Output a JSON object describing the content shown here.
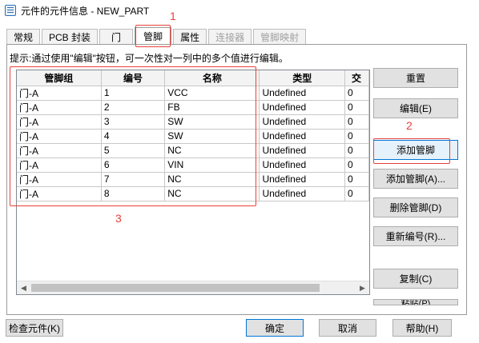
{
  "window": {
    "title": "元件的元件信息 - NEW_PART"
  },
  "tabs": [
    {
      "label": "常规"
    },
    {
      "label": "PCB 封装"
    },
    {
      "label": "门"
    },
    {
      "label": "管脚"
    },
    {
      "label": "属性"
    },
    {
      "label": "连接器"
    },
    {
      "label": "管脚映射"
    }
  ],
  "hint": "提示:通过使用\"编辑\"按钮，可一次性对一列中的多个值进行编辑。",
  "table": {
    "columns": [
      "管脚组",
      "编号",
      "名称",
      "类型",
      "交"
    ],
    "rows": [
      [
        "门-A",
        "1",
        "VCC",
        "Undefined",
        "0"
      ],
      [
        "门-A",
        "2",
        "FB",
        "Undefined",
        "0"
      ],
      [
        "门-A",
        "3",
        "SW",
        "Undefined",
        "0"
      ],
      [
        "门-A",
        "4",
        "SW",
        "Undefined",
        "0"
      ],
      [
        "门-A",
        "5",
        "NC",
        "Undefined",
        "0"
      ],
      [
        "门-A",
        "6",
        "VIN",
        "Undefined",
        "0"
      ],
      [
        "门-A",
        "7",
        "NC",
        "Undefined",
        "0"
      ],
      [
        "门-A",
        "8",
        "NC",
        "Undefined",
        "0"
      ]
    ]
  },
  "side_buttons": {
    "reset": "重置",
    "edit": "编辑(E)",
    "add_pin": "添加管脚",
    "add_pins": "添加管脚(A)...",
    "delete_pin": "删除管脚(D)",
    "renumber": "重新编号(R)...",
    "copy": "复制(C)",
    "paste": "粘贴(P)"
  },
  "bottom_buttons": {
    "check_part": "检查元件(K)",
    "ok": "确定",
    "cancel": "取消",
    "help": "帮助(H)"
  },
  "annotations": [
    "1",
    "2",
    "3"
  ],
  "colors": {
    "annotation": "#e8403a",
    "focus": "#0078d7"
  }
}
